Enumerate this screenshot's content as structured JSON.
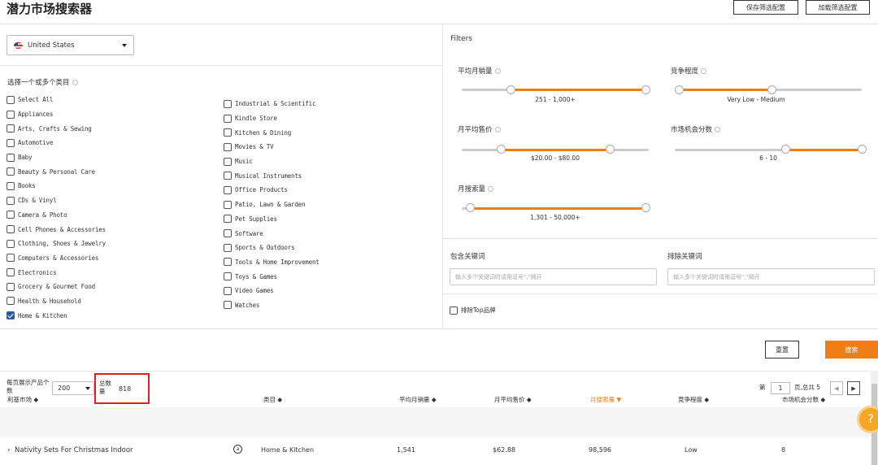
{
  "header": {
    "title": "潜力市场搜索器",
    "save_config": "保存筛选配置",
    "load_config": "加载筛选配置"
  },
  "country": {
    "selected": "United States"
  },
  "categories": {
    "label": "选择一个或多个类目",
    "left": [
      {
        "label": "Select All",
        "checked": false
      },
      {
        "label": "Appliances",
        "checked": false
      },
      {
        "label": "Arts, Crafts & Sewing",
        "checked": false
      },
      {
        "label": "Automotive",
        "checked": false
      },
      {
        "label": "Baby",
        "checked": false
      },
      {
        "label": "Beauty & Personal Care",
        "checked": false
      },
      {
        "label": "Books",
        "checked": false
      },
      {
        "label": "CDs & Vinyl",
        "checked": false
      },
      {
        "label": "Camera & Photo",
        "checked": false
      },
      {
        "label": "Cell Phones & Accessories",
        "checked": false
      },
      {
        "label": "Clothing, Shoes & Jewelry",
        "checked": false
      },
      {
        "label": "Computers & Accessories",
        "checked": false
      },
      {
        "label": "Electronics",
        "checked": false
      },
      {
        "label": "Grocery & Gourmet Food",
        "checked": false
      },
      {
        "label": "Health & Household",
        "checked": false
      },
      {
        "label": "Home & Kitchen",
        "checked": true
      }
    ],
    "right": [
      {
        "label": "Industrial & Scientific",
        "checked": false
      },
      {
        "label": "Kindle Store",
        "checked": false
      },
      {
        "label": "Kitchen & Dining",
        "checked": false
      },
      {
        "label": "Movies & TV",
        "checked": false
      },
      {
        "label": "Music",
        "checked": false
      },
      {
        "label": "Musical Instruments",
        "checked": false
      },
      {
        "label": "Office Products",
        "checked": false
      },
      {
        "label": "Patio, Lawn & Garden",
        "checked": false
      },
      {
        "label": "Pet Supplies",
        "checked": false
      },
      {
        "label": "Software",
        "checked": false
      },
      {
        "label": "Sports & Outdoors",
        "checked": false
      },
      {
        "label": "Tools & Home Improvement",
        "checked": false
      },
      {
        "label": "Toys & Games",
        "checked": false
      },
      {
        "label": "Video Games",
        "checked": false
      },
      {
        "label": "Watches",
        "checked": false
      }
    ]
  },
  "filters": {
    "title": "Filters",
    "avg_monthly_sales": {
      "label": "平均月销量",
      "range_text": "251  -  1,000+"
    },
    "competition": {
      "label": "竞争程度",
      "range_text": "Very Low  -  Medium"
    },
    "avg_monthly_price": {
      "label": "月平均售价",
      "range_text": "$20.00  -  $80.00"
    },
    "opportunity_score": {
      "label": "市场机会分数",
      "range_text": "6  -  10"
    },
    "monthly_search": {
      "label": "月搜索量",
      "range_text": "1,301  -  50,000+"
    }
  },
  "keywords": {
    "include_label": "包含关键词",
    "exclude_label": "排除关键词",
    "include_placeholder": "输入多个关键词时请用逗号\",\"隔开",
    "exclude_placeholder": "输入多个关键词时请用逗号\",\"隔开",
    "exclude_top_brands": "排除Top品牌"
  },
  "actions": {
    "reset": "重置",
    "search": "搜索"
  },
  "results": {
    "per_page_label": "每页展示产品个数",
    "per_page_value": "200",
    "total_label": "总数量",
    "total_value": "818",
    "page_prefix": "第",
    "page_value": "1",
    "page_suffix": "页,总共 5"
  },
  "table": {
    "columns": [
      "利基市场 ◆",
      "类目 ◆",
      "平均月销量 ◆",
      "月平均售价 ◆",
      "月搜索量 ▼",
      "竞争程度 ◆",
      "市场机会分数 ◆"
    ],
    "rows": [
      [
        "Nativity Sets For Christmas Indoor",
        "Home & Kitchen",
        "1,541",
        "$62.88",
        "98,596",
        "Low",
        "8"
      ]
    ]
  },
  "colors": {
    "accent": "#f07e17",
    "highlight_box": "#e02020"
  }
}
